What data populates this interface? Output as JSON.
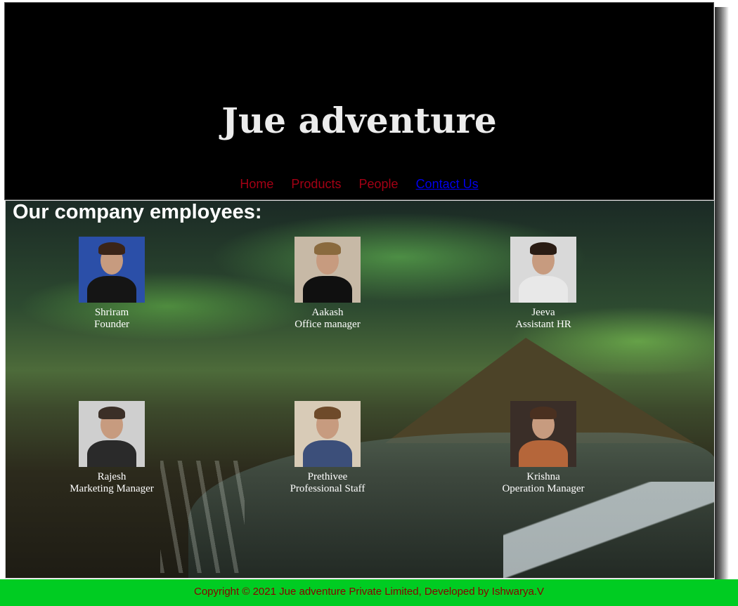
{
  "header": {
    "title": "Jue adventure"
  },
  "nav": {
    "items": [
      {
        "label": "Home"
      },
      {
        "label": "Products"
      },
      {
        "label": "People"
      },
      {
        "label": "Contact Us"
      }
    ]
  },
  "main": {
    "heading": "Our company employees:",
    "employees": [
      {
        "name": "Shriram",
        "role": "Founder",
        "photo_bg": "#2b4fa8",
        "photo_body": "#151515",
        "photo_hair": "#3a2418"
      },
      {
        "name": "Aakash",
        "role": "Office manager",
        "photo_bg": "#c7b9a6",
        "photo_body": "#101010",
        "photo_hair": "#8a6a3e"
      },
      {
        "name": "Jeeva",
        "role": "Assistant HR",
        "photo_bg": "#d9d9d9",
        "photo_body": "#e8e8e8",
        "photo_hair": "#2a1c14"
      },
      {
        "name": "Rajesh",
        "role": "Marketing Manager",
        "photo_bg": "#cfcfcf",
        "photo_body": "#2a2a2a",
        "photo_hair": "#3b2f27"
      },
      {
        "name": "Prethivee",
        "role": "Professional Staff",
        "photo_bg": "#d8cbb7",
        "photo_body": "#3c4f7a",
        "photo_hair": "#6e4a2a"
      },
      {
        "name": "Krishna",
        "role": "Operation Manager",
        "photo_bg": "#3a2e28",
        "photo_body": "#b5663a",
        "photo_hair": "#4a3020"
      }
    ]
  },
  "footer": {
    "text": "Copyright © 2021 Jue adventure Private Limited, Developed by Ishwarya.V"
  },
  "colors": {
    "header_bg": "#000000",
    "nav_link": "#a30014",
    "nav_link_active": "#0000ee",
    "footer_bg": "#00cc22",
    "footer_text": "#8a0000"
  }
}
